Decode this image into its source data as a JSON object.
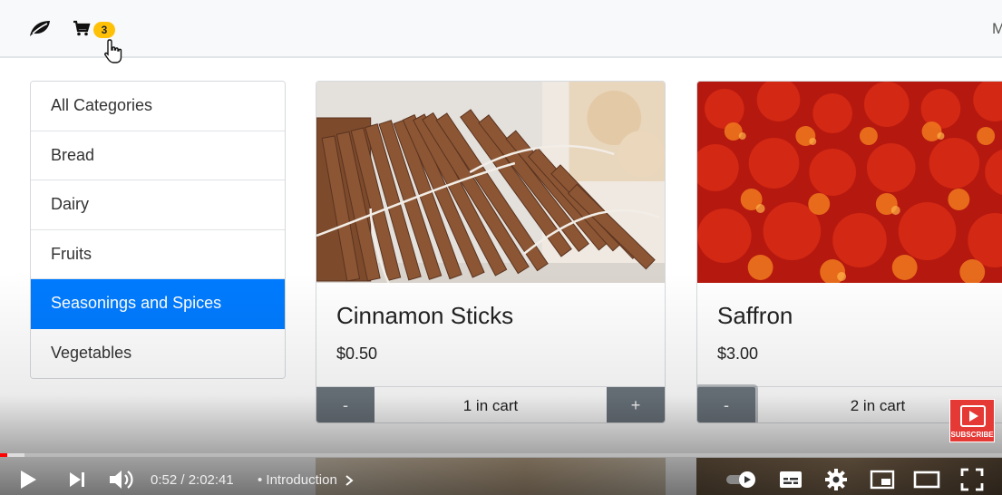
{
  "navbar": {
    "cart_count": "3",
    "right_partial": "M"
  },
  "categories": [
    {
      "label": "All Categories",
      "active": false
    },
    {
      "label": "Bread",
      "active": false
    },
    {
      "label": "Dairy",
      "active": false
    },
    {
      "label": "Fruits",
      "active": false
    },
    {
      "label": "Seasonings and Spices",
      "active": true
    },
    {
      "label": "Vegetables",
      "active": false
    }
  ],
  "products": [
    {
      "name": "Cinnamon Sticks",
      "price": "$0.50",
      "in_cart": "1 in cart",
      "minus_label": "-",
      "plus_label": "+"
    },
    {
      "name": "Saffron",
      "price": "$3.00",
      "in_cart": "2 in cart",
      "minus_label": "-"
    }
  ],
  "player": {
    "time": "0:52 / 2:02:41",
    "chapter": "• Introduction",
    "subscribe_label": "SUBSCRIBE",
    "progress_played": 0.007,
    "progress_loaded": 0.024
  },
  "colors": {
    "active_category": "#007bff",
    "qty_button": "#6c757d",
    "badge": "#ffc107",
    "progress": "#ff0000"
  }
}
